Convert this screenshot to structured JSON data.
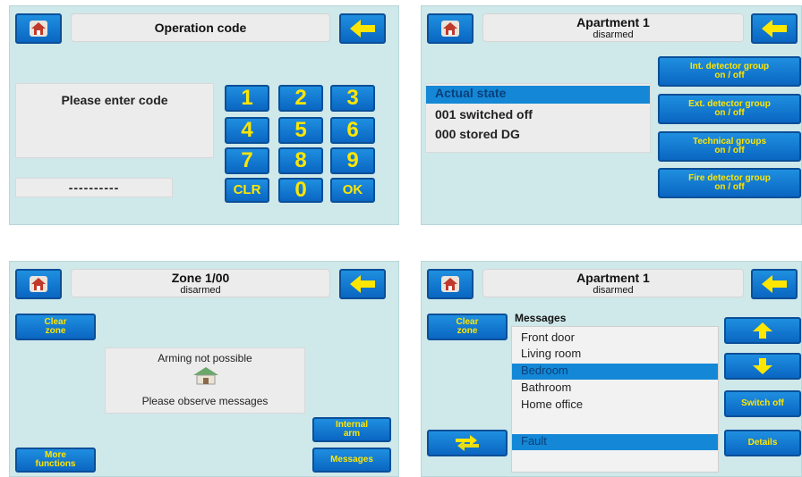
{
  "panel1": {
    "title": "Operation code",
    "prompt": "Please enter code",
    "code_mask": "----------",
    "keys": [
      "1",
      "2",
      "3",
      "4",
      "5",
      "6",
      "7",
      "8",
      "9",
      "CLR",
      "0",
      "OK"
    ]
  },
  "panel2": {
    "title": "Apartment 1",
    "subtitle": "disarmed",
    "list": [
      "Actual state",
      "001 switched off",
      "000 stored DG"
    ],
    "buttons": [
      {
        "l1": "Int. detector group",
        "l2": "on / off"
      },
      {
        "l1": "Ext. detector group",
        "l2": "on / off"
      },
      {
        "l1": "Technical groups",
        "l2": "on / off"
      },
      {
        "l1": "Fire detector group",
        "l2": "on / off"
      }
    ]
  },
  "panel3": {
    "title": "Zone 1/00",
    "subtitle": "disarmed",
    "clear_zone": {
      "l1": "Clear",
      "l2": "zone"
    },
    "msg1": "Arming not possible",
    "msg2": "Please observe messages",
    "more_functions": {
      "l1": "More",
      "l2": "functions"
    },
    "internal_arm": {
      "l1": "Internal",
      "l2": "arm"
    },
    "messages_btn": "Messages"
  },
  "panel4": {
    "title": "Apartment 1",
    "subtitle": "disarmed",
    "clear_zone": {
      "l1": "Clear",
      "l2": "zone"
    },
    "messages_label": "Messages",
    "items": [
      "Front door",
      "Living room",
      "Bedroom",
      "Bathroom",
      "Home office"
    ],
    "selected_item": "Bedroom",
    "lower_item": "Fault",
    "switch_off": "Switch off",
    "details": "Details"
  },
  "colors": {
    "panel_bg": "#cfe8ea",
    "button_blue": "#0a66c2",
    "button_text": "#ffe600",
    "selection": "#1488d6"
  },
  "icons": [
    "home-icon",
    "back-arrow-icon",
    "arrow-up-icon",
    "arrow-down-icon",
    "swap-icon",
    "house-warning-icon"
  ]
}
